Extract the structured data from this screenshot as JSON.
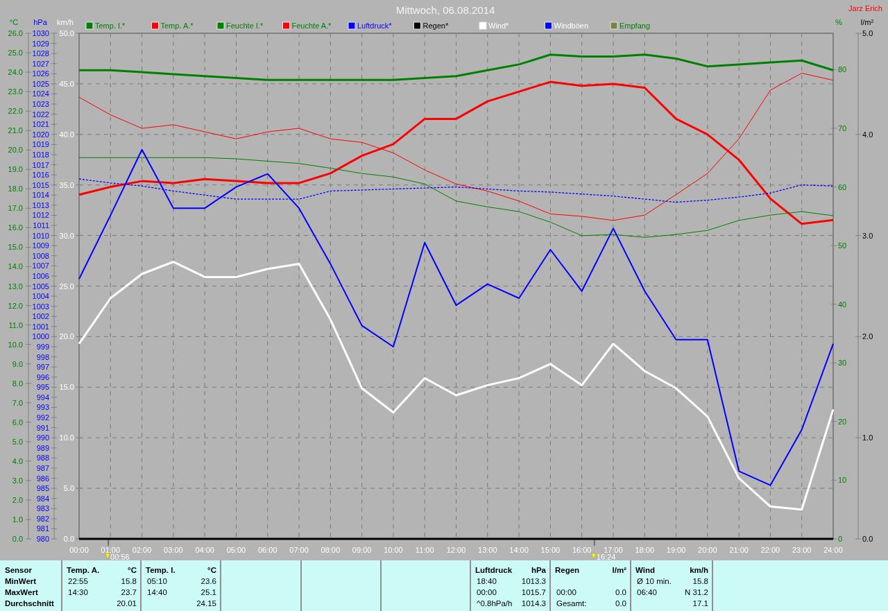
{
  "title": "Mittwoch, 06.08.2014",
  "station_owner": "Jarz Erich",
  "chart_data": {
    "type": "line",
    "xlim": [
      0,
      24
    ],
    "ylim": [
      0,
      50
    ],
    "ylabel": "km/h",
    "grid": true,
    "legend": "top",
    "y2label": "°C",
    "y3label": "%",
    "x": [
      0,
      1,
      2,
      3,
      4,
      5,
      6,
      7,
      8,
      9,
      10,
      11,
      12,
      13,
      14,
      15,
      16,
      17,
      18,
      19,
      20,
      21,
      22,
      23,
      24
    ],
    "xticks": [
      {
        "value": 0,
        "label": "00:00"
      },
      {
        "value": 1,
        "label": "01:00"
      },
      {
        "value": 2,
        "label": "02:00"
      },
      {
        "value": 3,
        "label": "03:00"
      },
      {
        "value": 4,
        "label": "04:00"
      },
      {
        "value": 5,
        "label": "05:00"
      },
      {
        "value": 6,
        "label": "06:00"
      },
      {
        "value": 7,
        "label": "07:00"
      },
      {
        "value": 8,
        "label": "08:00"
      },
      {
        "value": 9,
        "label": "09:00"
      },
      {
        "value": 10,
        "label": "10:00"
      },
      {
        "value": 11,
        "label": "11:00"
      },
      {
        "value": 12,
        "label": "12:00"
      },
      {
        "value": 13,
        "label": "13:00"
      },
      {
        "value": 14,
        "label": "14:00"
      },
      {
        "value": 15,
        "label": "15:00"
      },
      {
        "value": 16,
        "label": "16:00"
      },
      {
        "value": 17,
        "label": "17:00"
      },
      {
        "value": 18,
        "label": "18:00"
      },
      {
        "value": 19,
        "label": "19:00"
      },
      {
        "value": 20,
        "label": "20:00"
      },
      {
        "value": 21,
        "label": "21:00"
      },
      {
        "value": 22,
        "label": "22:00"
      },
      {
        "value": 23,
        "label": "23:00"
      },
      {
        "value": 24,
        "label": "24:00"
      }
    ],
    "yticks": [
      {
        "value": 0,
        "label": "0.0"
      },
      {
        "value": 5,
        "label": "5.0"
      },
      {
        "value": 10,
        "label": "10.0"
      },
      {
        "value": 15,
        "label": "15.0"
      },
      {
        "value": 20,
        "label": "20.0"
      },
      {
        "value": 25,
        "label": "25.0"
      },
      {
        "value": 30,
        "label": "30.0"
      },
      {
        "value": 35,
        "label": "35.0"
      },
      {
        "value": 40,
        "label": "40.0"
      },
      {
        "value": 45,
        "label": "45.0"
      },
      {
        "value": 50,
        "label": "50.0"
      }
    ],
    "y2lim": [
      0,
      26
    ],
    "y2ticks": [
      {
        "value": 0,
        "label": "0.0"
      },
      {
        "value": 1,
        "label": "1.0"
      },
      {
        "value": 2,
        "label": "2.0"
      },
      {
        "value": 3,
        "label": "3.0"
      },
      {
        "value": 4,
        "label": "4.0"
      },
      {
        "value": 5,
        "label": "5.0"
      },
      {
        "value": 6,
        "label": "6.0"
      },
      {
        "value": 7,
        "label": "7.0"
      },
      {
        "value": 8,
        "label": "8.0"
      },
      {
        "value": 9,
        "label": "9.0"
      },
      {
        "value": 10,
        "label": "10.0"
      },
      {
        "value": 11,
        "label": "11.0"
      },
      {
        "value": 12,
        "label": "12.0"
      },
      {
        "value": 13,
        "label": "13.0"
      },
      {
        "value": 14,
        "label": "14.0"
      },
      {
        "value": 15,
        "label": "15.0"
      },
      {
        "value": 16,
        "label": "16.0"
      },
      {
        "value": 17,
        "label": "17.0"
      },
      {
        "value": 18,
        "label": "18.0"
      },
      {
        "value": 19,
        "label": "19.0"
      },
      {
        "value": 20,
        "label": "20.0"
      },
      {
        "value": 21,
        "label": "21.0"
      },
      {
        "value": 22,
        "label": "22.0"
      },
      {
        "value": 23,
        "label": "23.0"
      },
      {
        "value": 24,
        "label": "24.0"
      },
      {
        "value": 25,
        "label": "25.0"
      },
      {
        "value": 26,
        "label": "26.0"
      }
    ],
    "y3lim": [
      0,
      86.2
    ],
    "y3ticks": [
      0,
      10,
      20,
      30,
      40,
      50,
      60,
      70,
      80
    ],
    "series": [
      {
        "name": "Temp. I.*",
        "color": "#008000",
        "axis": "y2",
        "values": [
          24.1,
          24.1,
          24.0,
          23.9,
          23.8,
          23.7,
          23.6,
          23.6,
          23.6,
          23.6,
          23.6,
          23.7,
          23.8,
          24.1,
          24.4,
          24.9,
          24.8,
          24.8,
          24.9,
          24.7,
          24.3,
          24.4,
          24.5,
          24.6,
          24.1
        ]
      },
      {
        "name": "Temp. A.*",
        "color": "#ff0000",
        "axis": "y2",
        "values": [
          17.7,
          18.1,
          18.4,
          18.3,
          18.5,
          18.4,
          18.3,
          18.3,
          18.8,
          19.7,
          20.3,
          21.6,
          21.6,
          22.5,
          23.0,
          23.5,
          23.3,
          23.4,
          23.2,
          21.6,
          20.8,
          19.5,
          17.5,
          16.2,
          16.4
        ]
      },
      {
        "name": "Feuchte I.*",
        "color": "#008000",
        "axis": "y3",
        "values": [
          65.0,
          65.0,
          65.0,
          65.0,
          65.0,
          64.8,
          64.4,
          64.0,
          63.2,
          62.3,
          61.7,
          60.5,
          57.6,
          56.6,
          55.8,
          54.0,
          51.7,
          51.9,
          51.4,
          51.9,
          52.6,
          54.3,
          55.2,
          55.8,
          55.1
        ]
      },
      {
        "name": "Feuchte A.*",
        "color": "#ff0000",
        "axis": "y3",
        "values": [
          75.3,
          72.3,
          70.0,
          70.6,
          69.4,
          68.2,
          69.4,
          70.0,
          68.2,
          67.6,
          65.8,
          62.9,
          60.5,
          59.3,
          57.6,
          55.4,
          55.0,
          54.3,
          55.2,
          58.7,
          62.3,
          68.2,
          76.5,
          79.4,
          78.2
        ]
      },
      {
        "name": "Wind*",
        "color": "#ffffff",
        "values": [
          19.3,
          23.8,
          26.2,
          27.4,
          25.9,
          25.9,
          26.7,
          27.2,
          21.7,
          14.9,
          12.5,
          15.9,
          14.2,
          15.2,
          15.9,
          17.3,
          15.2,
          19.3,
          16.6,
          14.9,
          12.1,
          6.0,
          3.2,
          2.9,
          12.8
        ]
      },
      {
        "name": "Windböen",
        "color": "#0000ff",
        "values": [
          25.7,
          32.0,
          38.5,
          32.7,
          32.7,
          34.8,
          36.1,
          32.7,
          27.2,
          21.1,
          19.0,
          29.3,
          23.1,
          25.2,
          23.8,
          28.6,
          24.5,
          30.7,
          24.5,
          19.7,
          19.7,
          6.7,
          5.3,
          10.8,
          19.3
        ]
      },
      {
        "name": "Empfang",
        "color": "#808040",
        "axis": "y3",
        "values": [
          null,
          null,
          null,
          null,
          null,
          null,
          null,
          null,
          null,
          null,
          null,
          null,
          null,
          null,
          null,
          null,
          null,
          null,
          null,
          null,
          null,
          null,
          null,
          null,
          null
        ]
      }
    ],
    "annotations": [
      "00:56",
      "16:24"
    ]
  },
  "pressure_overlay": {
    "chart_data": {
      "type": "line",
      "xlim": [
        0,
        24
      ],
      "ylim": [
        980,
        1030
      ],
      "ylabel": "hPa",
      "y2label": "l/m²",
      "x": [
        0,
        1,
        2,
        3,
        4,
        5,
        6,
        7,
        8,
        9,
        10,
        11,
        12,
        13,
        14,
        15,
        16,
        17,
        18,
        19,
        20,
        21,
        22,
        23,
        24
      ],
      "yticks": [
        980,
        981,
        982,
        983,
        984,
        985,
        986,
        987,
        988,
        989,
        990,
        991,
        992,
        993,
        994,
        995,
        996,
        997,
        998,
        999,
        1000,
        1001,
        1002,
        1003,
        1004,
        1005,
        1006,
        1007,
        1008,
        1009,
        1010,
        1011,
        1012,
        1013,
        1014,
        1015,
        1016,
        1017,
        1018,
        1019,
        1020,
        1021,
        1022,
        1023,
        1024,
        1025,
        1026,
        1027,
        1028,
        1029,
        1030
      ],
      "y2lim": [
        0,
        5
      ],
      "y2ticks": [
        {
          "value": 0,
          "label": "0.0"
        },
        {
          "value": 1,
          "label": "1.0"
        },
        {
          "value": 2,
          "label": "2.0"
        },
        {
          "value": 3,
          "label": "3.0"
        },
        {
          "value": 4,
          "label": "4.0"
        },
        {
          "value": 5,
          "label": "5.0"
        }
      ],
      "series": [
        {
          "name": "Luftdruck*",
          "color": "#0000ff",
          "line_style": "dotted",
          "values": [
            1015.6,
            1015.2,
            1014.9,
            1014.4,
            1014.0,
            1013.6,
            1013.6,
            1013.6,
            1014.4,
            1014.5,
            1014.6,
            1014.7,
            1014.8,
            1014.6,
            1014.4,
            1014.3,
            1014.1,
            1013.9,
            1013.6,
            1013.3,
            1013.5,
            1013.8,
            1014.2,
            1015.0,
            1014.9
          ]
        },
        {
          "name": "Regen*",
          "color": "#000000",
          "axis": "y2",
          "values": [
            0,
            0,
            0,
            0,
            0,
            0,
            0,
            0,
            0,
            0,
            0,
            0,
            0,
            0,
            0,
            0,
            0,
            0,
            0,
            0,
            0,
            0,
            0,
            0,
            0
          ]
        }
      ]
    }
  },
  "summary": {
    "header": "Sensor",
    "row_labels": [
      "MinWert",
      "MaxWert",
      "Durchschnitt"
    ],
    "groups": [
      {
        "title": "Temp. A.",
        "unit": "°C",
        "rows": [
          {
            "time": "22:55",
            "value": "15.8"
          },
          {
            "time": "14:30",
            "value": "23.7"
          },
          {
            "value": "20.01"
          }
        ]
      },
      {
        "title": "Temp. I.",
        "unit": "°C",
        "rows": [
          {
            "time": "05:10",
            "value": "23.6"
          },
          {
            "time": "14:40",
            "value": "25.1"
          },
          {
            "value": "24.15"
          }
        ]
      },
      {
        "title": "Luftdruck",
        "unit": "hPa",
        "rows": [
          {
            "time": "18:40",
            "value": "1013.3"
          },
          {
            "time": "00:00",
            "value": "1015.7"
          },
          {
            "time": "^0.8hPa/h",
            "value": "1014.3"
          }
        ]
      },
      {
        "title": "Regen",
        "unit": "l/m²",
        "rows": [
          {},
          {
            "time": "00:00",
            "value": "0.0"
          },
          {
            "time": "Gesamt:",
            "value": "0.0"
          }
        ]
      },
      {
        "title": "Wind",
        "unit": "km/h",
        "rows": [
          {
            "time": "Ø 10 min.",
            "value": "15.8"
          },
          {
            "time": "06:40",
            "value": "N 31.2"
          },
          {
            "value": "17.1"
          }
        ]
      }
    ]
  }
}
